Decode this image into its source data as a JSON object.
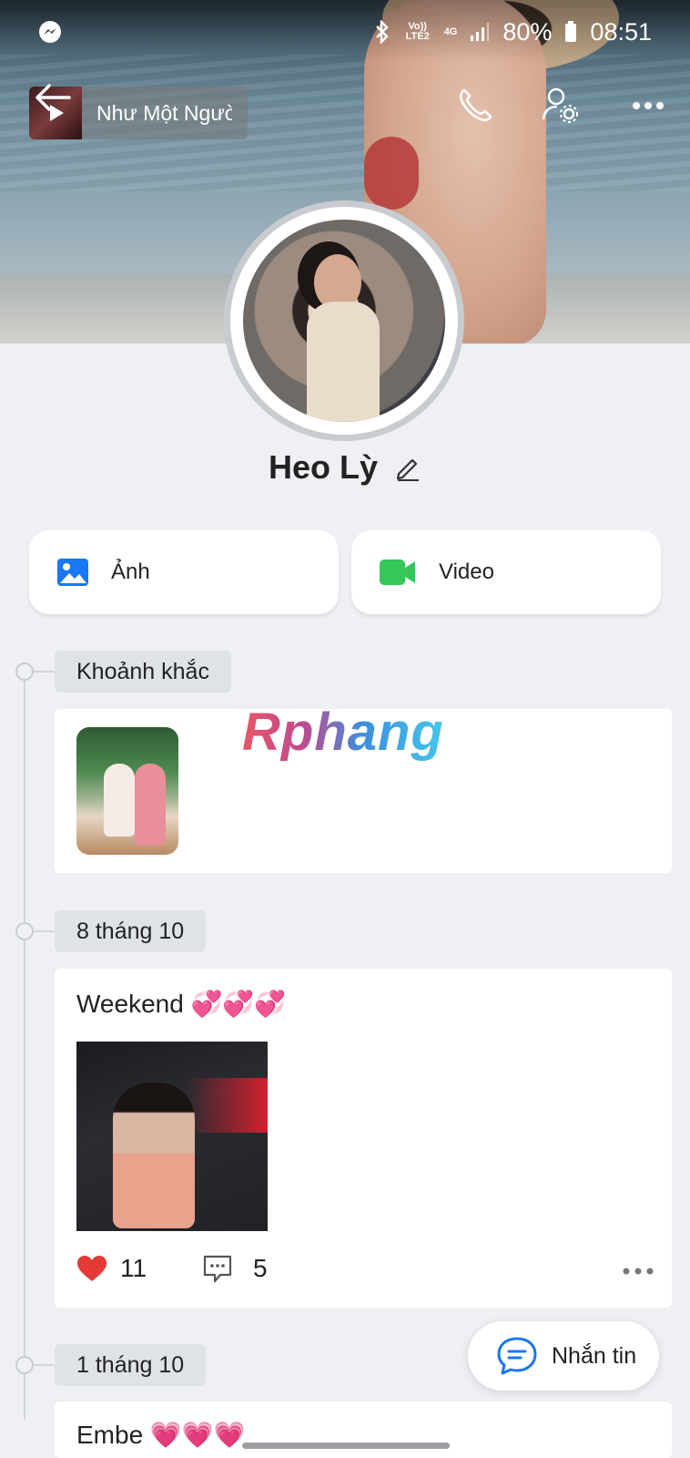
{
  "status_bar": {
    "bluetooth_icon": "bluetooth-icon",
    "volte_label": "Vo)) LTE2",
    "network_label": "4G",
    "battery": "80%",
    "time": "08:51"
  },
  "header": {
    "music_title": "Như Một Ngườ"
  },
  "profile": {
    "name": "Heo Lỳ"
  },
  "actions": {
    "photos_label": "Ảnh",
    "video_label": "Video"
  },
  "timeline": {
    "moments_label": "Khoảnh khắc",
    "watermark": "Rphang",
    "posts": [
      {
        "date": "8 tháng 10",
        "caption": "Weekend 💞💞💞",
        "likes": "11",
        "comments": "5"
      },
      {
        "date": "1 tháng 10",
        "caption": "Embe 💗💗💗"
      }
    ]
  },
  "fab": {
    "label": "Nhắn tin"
  },
  "colors": {
    "accent_blue": "#1877f2",
    "video_green": "#34c759",
    "heart_red": "#e53935"
  }
}
